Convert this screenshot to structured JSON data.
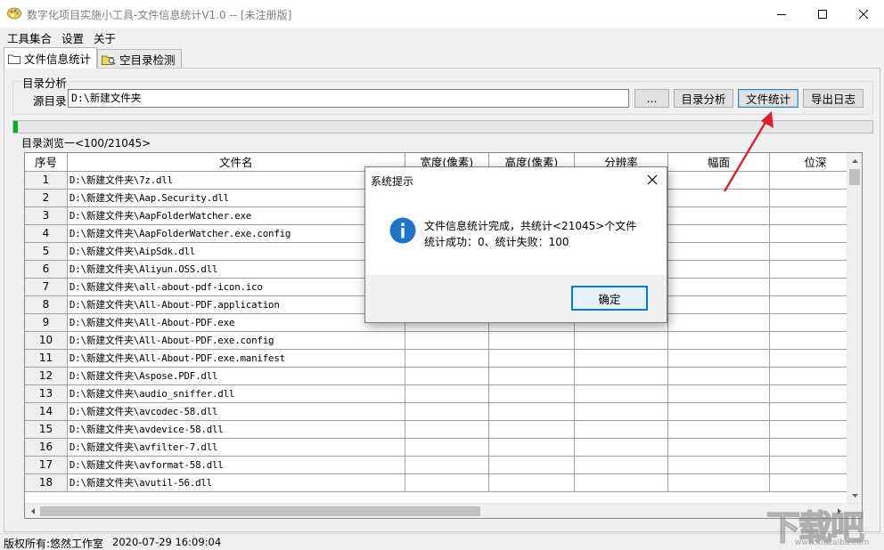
{
  "window": {
    "title": "数字化项目实施小工具-文件信息统计V1.0 -- [未注册版]",
    "controls": {
      "minimize": "minimize-icon",
      "maximize": "maximize-icon",
      "close": "close-icon"
    }
  },
  "menu": {
    "items": [
      "工具集合",
      "设置",
      "关于"
    ]
  },
  "tabs": [
    {
      "label": "文件信息统计",
      "icon": "folder-icon",
      "active": true
    },
    {
      "label": "空目录检测",
      "icon": "folder-search-icon",
      "active": false
    }
  ],
  "dir_analysis": {
    "group_label": "目录分析",
    "source_label": "源目录",
    "source_value": "D:\\新建文件夹",
    "browse_label": "...",
    "analyze_label": "目录分析",
    "stats_label": "文件统计",
    "export_label": "导出日志"
  },
  "progress": {
    "value": 0.005,
    "color": "#06b025"
  },
  "browse": {
    "label": "目录浏览一<100/21045>"
  },
  "table": {
    "columns": [
      "序号",
      "文件名",
      "宽度(像素)",
      "高度(像素)",
      "分辨率",
      "幅面",
      "位深"
    ],
    "rows": [
      {
        "no": "1",
        "name": "D:\\新建文件夹\\7z.dll"
      },
      {
        "no": "2",
        "name": "D:\\新建文件夹\\Aap.Security.dll"
      },
      {
        "no": "3",
        "name": "D:\\新建文件夹\\AapFolderWatcher.exe"
      },
      {
        "no": "4",
        "name": "D:\\新建文件夹\\AapFolderWatcher.exe.config"
      },
      {
        "no": "5",
        "name": "D:\\新建文件夹\\AipSdk.dll"
      },
      {
        "no": "6",
        "name": "D:\\新建文件夹\\Aliyun.OSS.dll"
      },
      {
        "no": "7",
        "name": "D:\\新建文件夹\\all-about-pdf-icon.ico"
      },
      {
        "no": "8",
        "name": "D:\\新建文件夹\\All-About-PDF.application"
      },
      {
        "no": "9",
        "name": "D:\\新建文件夹\\All-About-PDF.exe"
      },
      {
        "no": "10",
        "name": "D:\\新建文件夹\\All-About-PDF.exe.config"
      },
      {
        "no": "11",
        "name": "D:\\新建文件夹\\All-About-PDF.exe.manifest"
      },
      {
        "no": "12",
        "name": "D:\\新建文件夹\\Aspose.PDF.dll"
      },
      {
        "no": "13",
        "name": "D:\\新建文件夹\\audio_sniffer.dll"
      },
      {
        "no": "14",
        "name": "D:\\新建文件夹\\avcodec-58.dll"
      },
      {
        "no": "15",
        "name": "D:\\新建文件夹\\avdevice-58.dll"
      },
      {
        "no": "16",
        "name": "D:\\新建文件夹\\avfilter-7.dll"
      },
      {
        "no": "17",
        "name": "D:\\新建文件夹\\avformat-58.dll"
      },
      {
        "no": "18",
        "name": "D:\\新建文件夹\\avutil-56.dll"
      }
    ]
  },
  "status": {
    "copyright": "版权所有:悠然工作室",
    "timestamp": "2020-07-29 16:09:04"
  },
  "dialog": {
    "title": "系统提示",
    "icon": "info-icon",
    "message_line1": "文件信息统计完成，共统计<21045>个文件",
    "message_line2": "统计成功：0、统计失败：100",
    "ok_label": "确定"
  },
  "watermark": {
    "text": "下载吧",
    "sub": "www.xiazaiba.com"
  },
  "colors": {
    "accent": "#0078d7",
    "info_icon": "#1e74c8",
    "annotation_arrow": "#d9232a"
  }
}
